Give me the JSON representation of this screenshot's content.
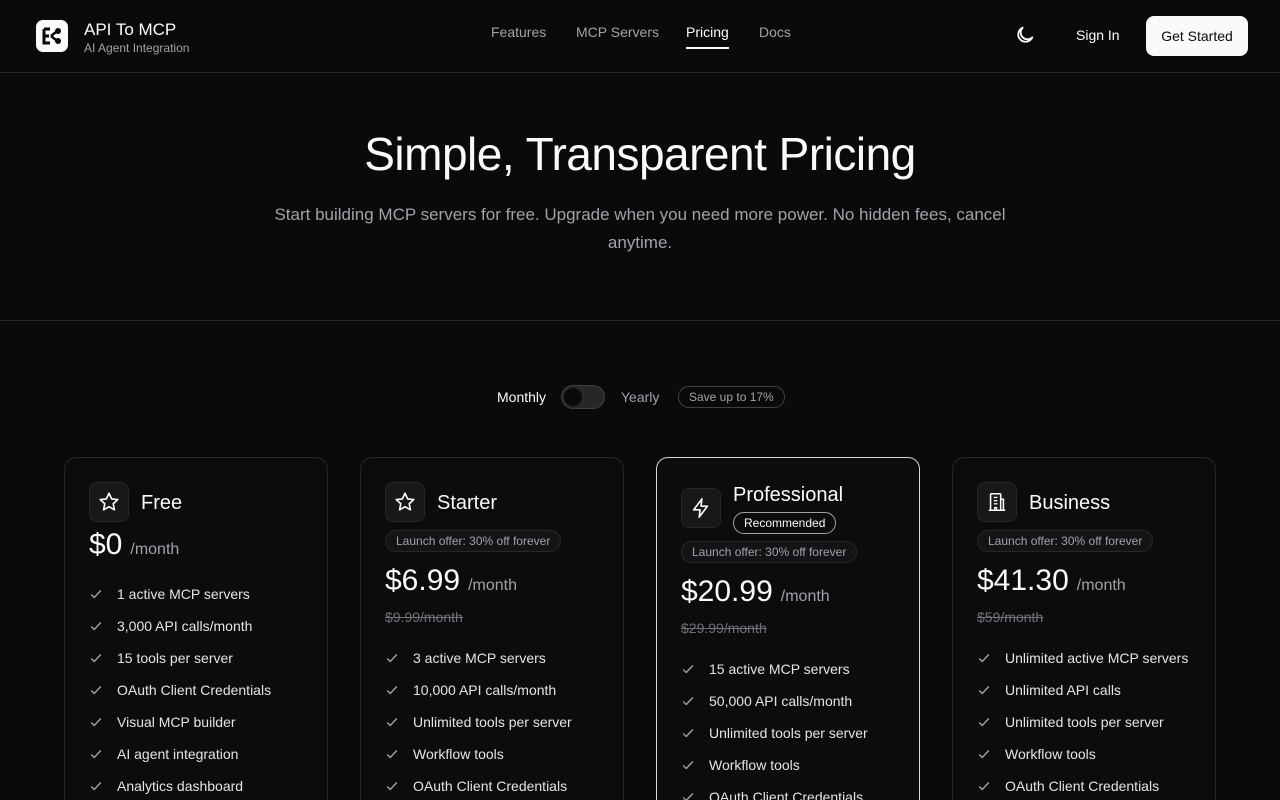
{
  "header": {
    "brand_title": "API To MCP",
    "brand_subtitle": "AI Agent Integration",
    "logo_icon": "mcp-logo-icon",
    "nav": [
      {
        "label": "Features",
        "active": false
      },
      {
        "label": "MCP Servers",
        "active": false
      },
      {
        "label": "Pricing",
        "active": true
      },
      {
        "label": "Docs",
        "active": false
      }
    ],
    "theme_icon": "moon-icon",
    "sign_in": "Sign In",
    "get_started": "Get Started"
  },
  "hero": {
    "title": "Simple, Transparent Pricing",
    "subtitle": "Start building MCP servers for free. Upgrade when you need more power. No hidden fees, cancel anytime."
  },
  "billing": {
    "monthly_label": "Monthly",
    "yearly_label": "Yearly",
    "save_badge": "Save up to 17%",
    "yearly_selected": false
  },
  "plans": [
    {
      "name": "Free",
      "icon": "star-icon",
      "recommended": "",
      "offer": "",
      "price": "$0",
      "period": "/month",
      "old_price": "",
      "features": [
        "1 active MCP servers",
        "3,000 API calls/month",
        "15 tools per server",
        "OAuth Client Credentials",
        "Visual MCP builder",
        "AI agent integration",
        "Analytics dashboard"
      ]
    },
    {
      "name": "Starter",
      "icon": "star-icon",
      "recommended": "",
      "offer": "Launch offer: 30% off forever",
      "price": "$6.99",
      "period": "/month",
      "old_price": "$9.99/month",
      "features": [
        "3 active MCP servers",
        "10,000 API calls/month",
        "Unlimited tools per server",
        "Workflow tools",
        "OAuth Client Credentials"
      ]
    },
    {
      "name": "Professional",
      "icon": "lightning-icon",
      "recommended": "Recommended",
      "offer": "Launch offer: 30% off forever",
      "price": "$20.99",
      "period": "/month",
      "old_price": "$29.99/month",
      "features": [
        "15 active MCP servers",
        "50,000 API calls/month",
        "Unlimited tools per server",
        "Workflow tools",
        "OAuth Client Credentials"
      ]
    },
    {
      "name": "Business",
      "icon": "building-icon",
      "recommended": "",
      "offer": "Launch offer: 30% off forever",
      "price": "$41.30",
      "period": "/month",
      "old_price": "$59/month",
      "features": [
        "Unlimited active MCP servers",
        "Unlimited API calls",
        "Unlimited tools per server",
        "Workflow tools",
        "OAuth Client Credentials"
      ]
    }
  ]
}
